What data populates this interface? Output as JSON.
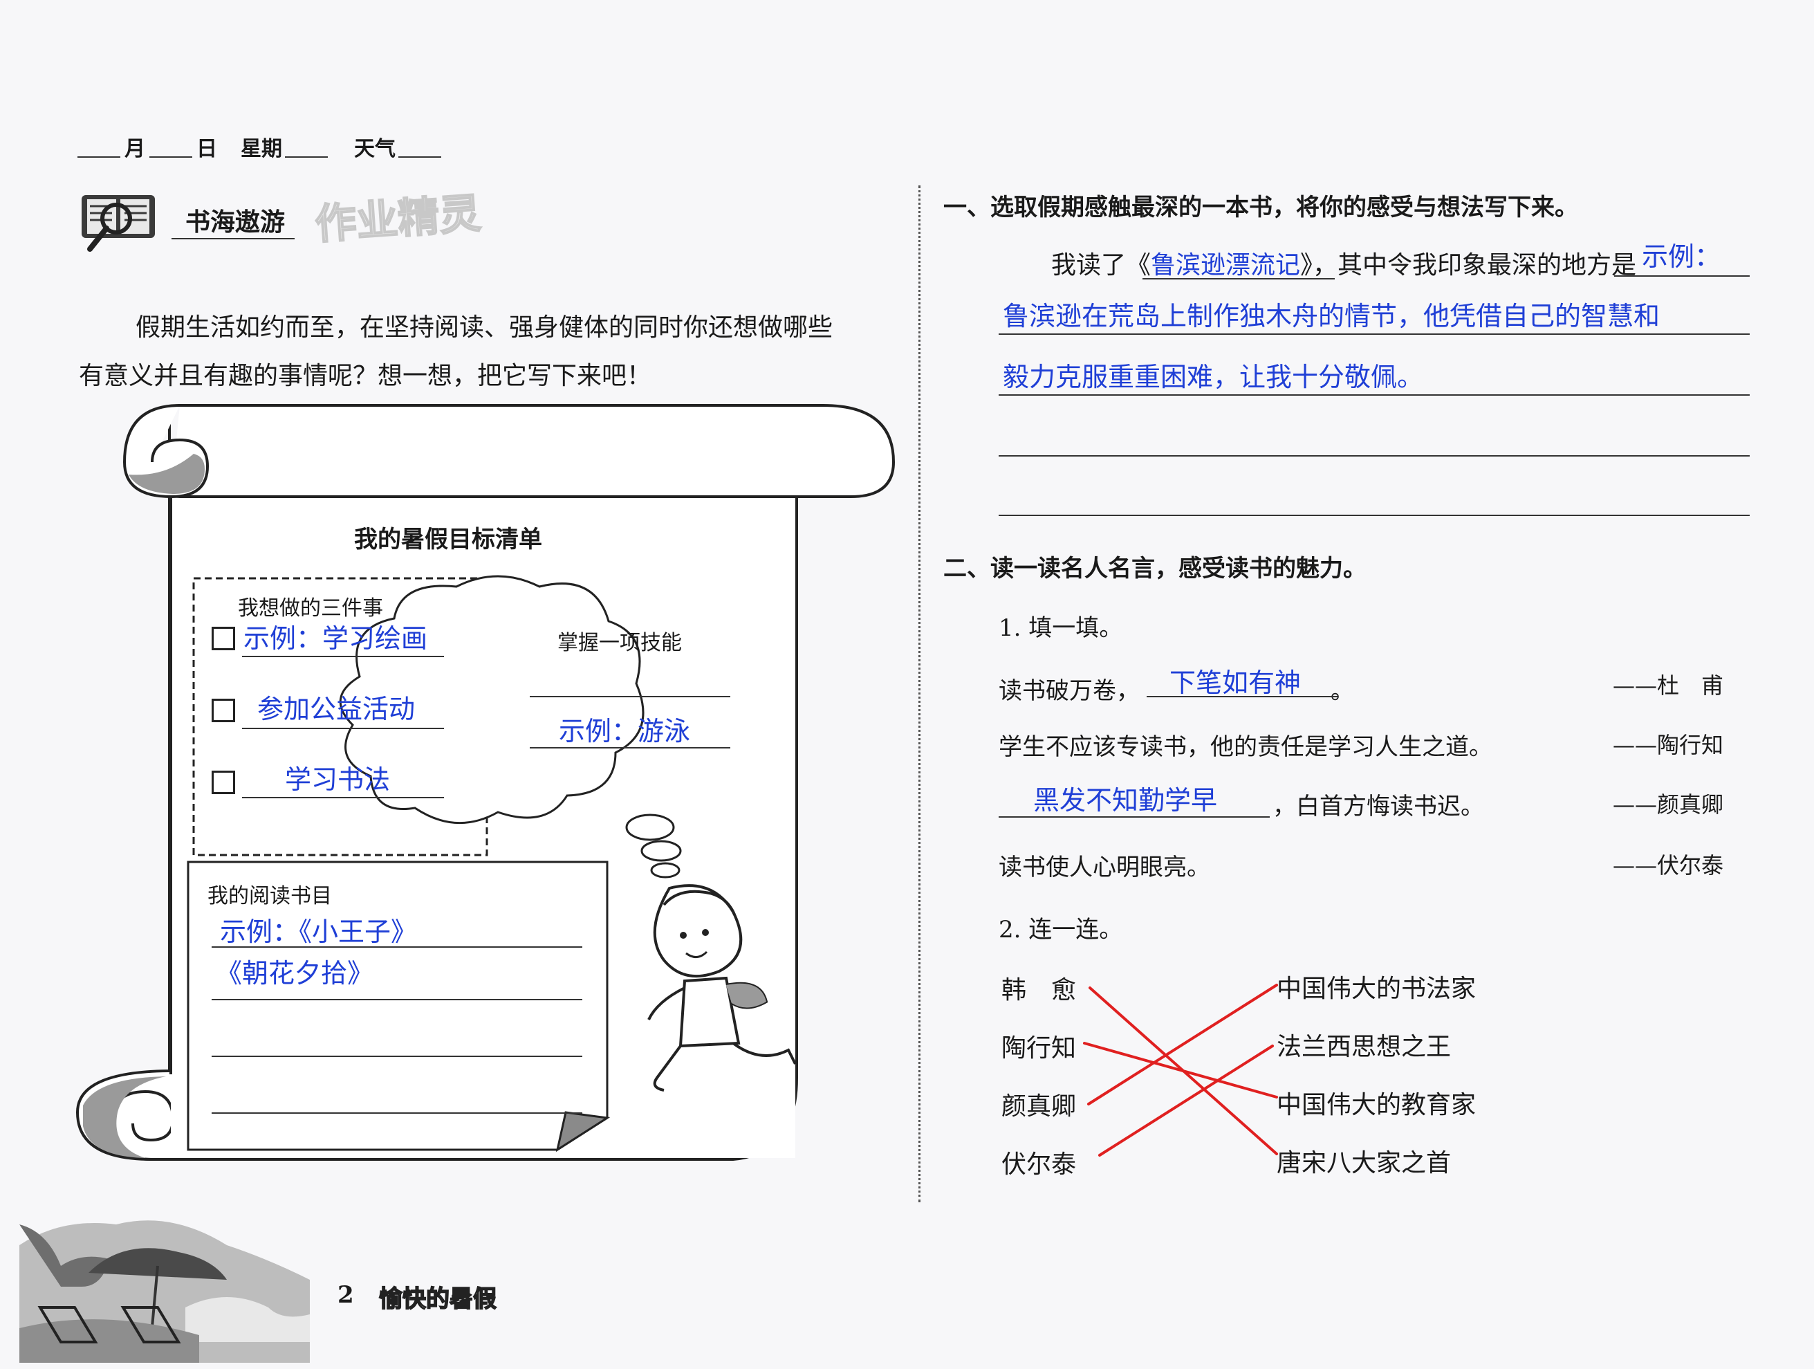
{
  "header": {
    "month_label": "月",
    "day_label": "日",
    "weekday_label": "星期",
    "weather_label": "天气"
  },
  "section": {
    "title": "书海遨游",
    "watermark": "作业精灵"
  },
  "intro": {
    "line1": "假期生活如约而至，在坚持阅读、强身健体的同时你还想做哪些",
    "line2": "有意义并且有趣的事情呢？想一想，把它写下来吧！"
  },
  "scroll": {
    "title": "我的暑假目标清单",
    "three_things_label": "我想做的三件事",
    "things": [
      "示例：学习绘画",
      "参加公益活动",
      "学习书法"
    ],
    "skill_label": "掌握一项技能",
    "skill_answer": "示例：游泳",
    "reading_label": "我的阅读书目",
    "books": [
      "示例：《小王子》",
      "《朝花夕拾》"
    ]
  },
  "q1": {
    "heading": "一、选取假期感触最深的一本书，将你的感受与想法写下来。",
    "prefix": "我读了《",
    "book": "鲁滨逊漂流记",
    "middle": "》，其中令我印象最深的地方是",
    "answer_start": "示例：",
    "answer_line2": "鲁滨逊在荒岛上制作独木舟的情节，他凭借自己的智慧和",
    "answer_line3": "毅力克服重重困难，让我十分敬佩。"
  },
  "q2": {
    "heading": "二、读一读名人名言，感受读书的魅力。",
    "sub1": "1. 填一填。",
    "quotes": [
      {
        "pre": "读书破万卷，",
        "answer": "下笔如有神",
        "post": "。",
        "author": "——杜　甫"
      },
      {
        "pre": "学生不应该专读书，他的责任是学习人生之道。",
        "answer": "",
        "post": "",
        "author": "——陶行知"
      },
      {
        "pre": "",
        "answer": "黑发不知勤学早",
        "post": "，白首方悔读书迟。",
        "author": "——颜真卿"
      },
      {
        "pre": "读书使人心明眼亮。",
        "answer": "",
        "post": "",
        "author": "——伏尔泰"
      }
    ],
    "sub2": "2. 连一连。",
    "people": [
      "韩　愈",
      "陶行知",
      "颜真卿",
      "伏尔泰"
    ],
    "titles": [
      "中国伟大的书法家",
      "法兰西思想之王",
      "中国伟大的教育家",
      "唐宋八大家之首"
    ]
  },
  "footer": {
    "page_number": "2",
    "book_title": "愉快的暑假"
  },
  "colors": {
    "answer_blue": "#1f3fd6",
    "match_red": "#e02020"
  }
}
